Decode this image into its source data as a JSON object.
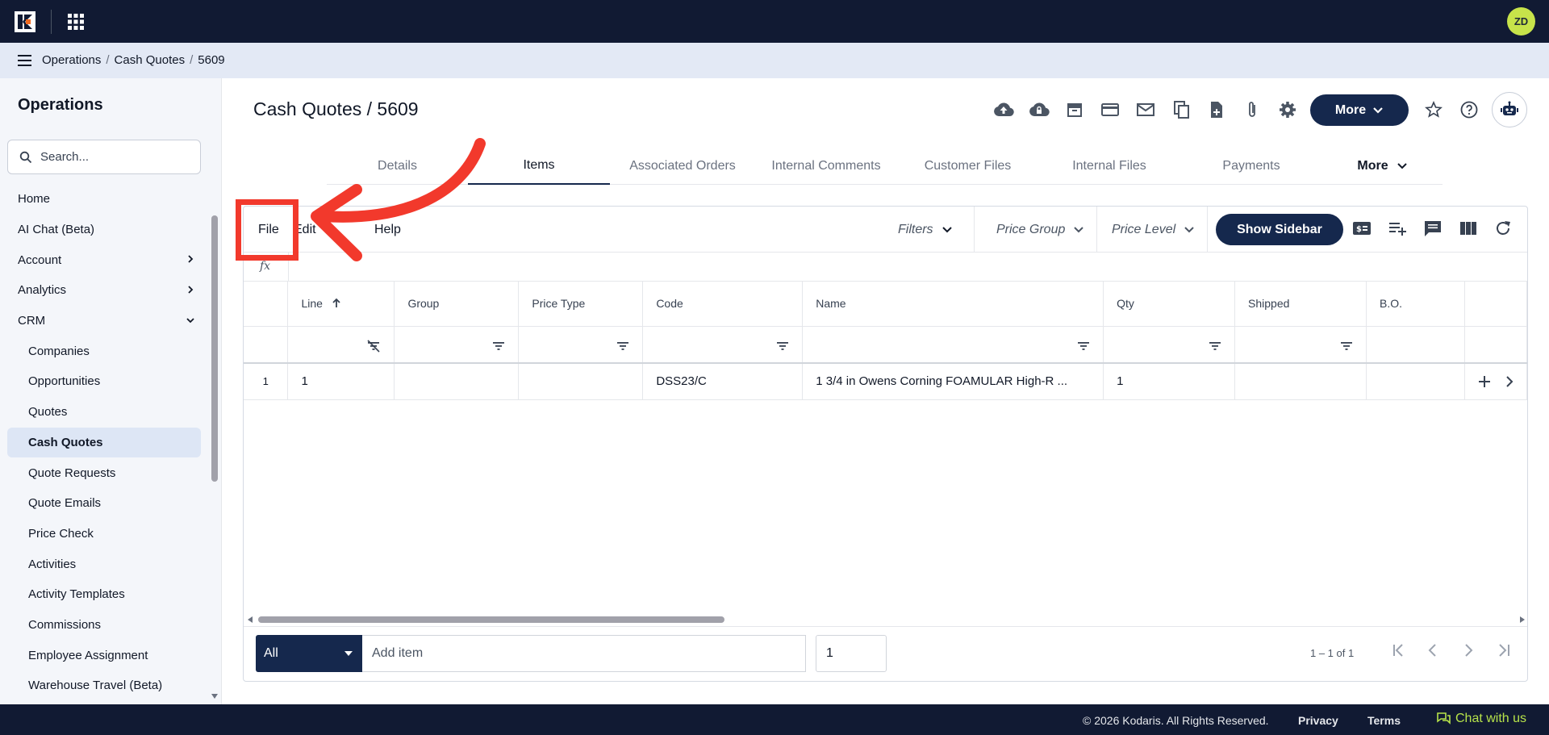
{
  "topbar": {
    "user_initials": "ZD"
  },
  "breadcrumb": [
    "Operations",
    "Cash Quotes",
    "5609"
  ],
  "breadcrumb_sep": "/",
  "sidebar": {
    "title": "Operations",
    "search_placeholder": "Search...",
    "items": [
      {
        "label": "Home",
        "level": "top"
      },
      {
        "label": "AI Chat (Beta)",
        "level": "top"
      },
      {
        "label": "Account",
        "level": "top",
        "chevron": "right"
      },
      {
        "label": "Analytics",
        "level": "top",
        "chevron": "right"
      },
      {
        "label": "CRM",
        "level": "top",
        "chevron": "down"
      },
      {
        "label": "Companies",
        "level": "sub"
      },
      {
        "label": "Opportunities",
        "level": "sub"
      },
      {
        "label": "Quotes",
        "level": "sub"
      },
      {
        "label": "Cash Quotes",
        "level": "sub",
        "active": true
      },
      {
        "label": "Quote Requests",
        "level": "sub"
      },
      {
        "label": "Quote Emails",
        "level": "sub"
      },
      {
        "label": "Price Check",
        "level": "sub"
      },
      {
        "label": "Activities",
        "level": "sub"
      },
      {
        "label": "Activity Templates",
        "level": "sub"
      },
      {
        "label": "Commissions",
        "level": "sub"
      },
      {
        "label": "Employee Assignment",
        "level": "sub"
      },
      {
        "label": "Warehouse Travel (Beta)",
        "level": "sub"
      }
    ]
  },
  "header": {
    "title": "Cash Quotes / 5609",
    "more_label": "More",
    "icons": [
      "cloud-upload-icon",
      "cloud-lock-icon",
      "archive-icon",
      "credit-card-icon",
      "mail-icon",
      "copy-icon",
      "new-file-icon",
      "attachment-icon",
      "settings-icon"
    ]
  },
  "tabs": [
    {
      "label": "Details"
    },
    {
      "label": "Items",
      "active": true
    },
    {
      "label": "Associated Orders"
    },
    {
      "label": "Internal Comments"
    },
    {
      "label": "Customer Files"
    },
    {
      "label": "Internal Files"
    },
    {
      "label": "Payments"
    },
    {
      "label": "More"
    }
  ],
  "grid_toolbar": {
    "menus": [
      "File",
      "Edit",
      "Help"
    ],
    "filters_label": "Filters",
    "price_group_label": "Price Group",
    "price_level_label": "Price Level",
    "show_sidebar_label": "Show Sidebar",
    "fx_label": "fx"
  },
  "table": {
    "columns": [
      "Line",
      "Group",
      "Price Type",
      "Code",
      "Name",
      "Qty",
      "Shipped",
      "B.O."
    ],
    "rows": [
      {
        "row_num": "1",
        "line": "1",
        "group": "",
        "price_type": "",
        "code": "DSS23/C",
        "name": "1 3/4 in Owens Corning FOAMULAR High-R ...",
        "qty": "1",
        "shipped": "",
        "bo": ""
      }
    ]
  },
  "add_bar": {
    "scope_value": "All",
    "add_item_placeholder": "Add item",
    "qty_value": "1",
    "range_text": "1 – 1 of 1"
  },
  "footer": {
    "copyright": "© 2026 Kodaris. All Rights Reserved.",
    "privacy": "Privacy",
    "terms": "Terms",
    "chat": "Chat with us"
  },
  "colors": {
    "navy": "#111a33",
    "primary": "#15284d",
    "accent_lime": "#c7e34a",
    "annotation_red": "#f2392c"
  }
}
